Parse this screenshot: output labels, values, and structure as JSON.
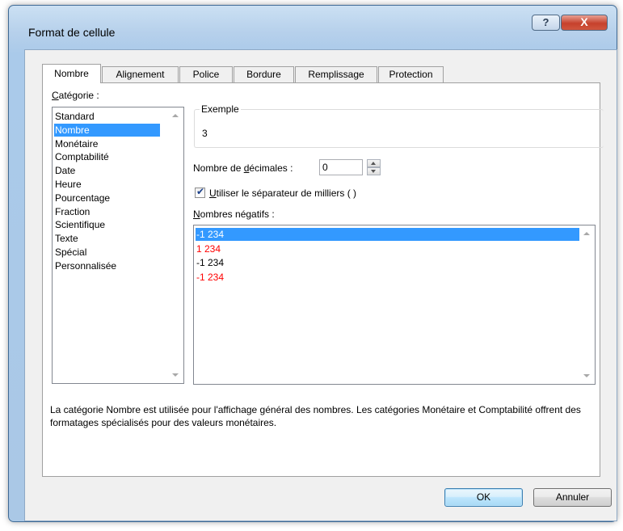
{
  "window": {
    "title": "Format de cellule",
    "help_glyph": "?",
    "close_glyph": "X"
  },
  "tabs": [
    {
      "label": "Nombre",
      "active": true
    },
    {
      "label": "Alignement"
    },
    {
      "label": "Police"
    },
    {
      "label": "Bordure"
    },
    {
      "label": "Remplissage"
    },
    {
      "label": "Protection"
    }
  ],
  "category": {
    "label_accel": "C",
    "label_rest": "atégorie :",
    "items": [
      "Standard",
      "Nombre",
      "Monétaire",
      "Comptabilité",
      "Date",
      "Heure",
      "Pourcentage",
      "Fraction",
      "Scientifique",
      "Texte",
      "Spécial",
      "Personnalisée"
    ],
    "selected_index": 1
  },
  "sample": {
    "title": "Exemple",
    "value": "3"
  },
  "decimals": {
    "label_pre": "Nombre de ",
    "label_accel": "d",
    "label_post": "écimales :",
    "value": "0"
  },
  "thousands": {
    "checked": true,
    "label_accel": "U",
    "label_rest": "tiliser le séparateur de milliers ( )"
  },
  "negatives": {
    "label_accel": "N",
    "label_rest": "ombres négatifs :",
    "items": [
      {
        "text": "-1 234",
        "color": "#000000"
      },
      {
        "text": "1 234",
        "color": "#ff0000"
      },
      {
        "text": "-1 234",
        "color": "#000000"
      },
      {
        "text": "-1 234",
        "color": "#ff0000"
      }
    ],
    "selected_index": 0
  },
  "description": "La catégorie Nombre est utilisée pour l'affichage général des nombres. Les catégories Monétaire et Comptabilité offrent des formatages spécialisés pour des valeurs monétaires.",
  "buttons": {
    "ok": "OK",
    "cancel": "Annuler"
  },
  "colors": {
    "selection": "#3399ff",
    "negative_red": "#ff0000"
  }
}
